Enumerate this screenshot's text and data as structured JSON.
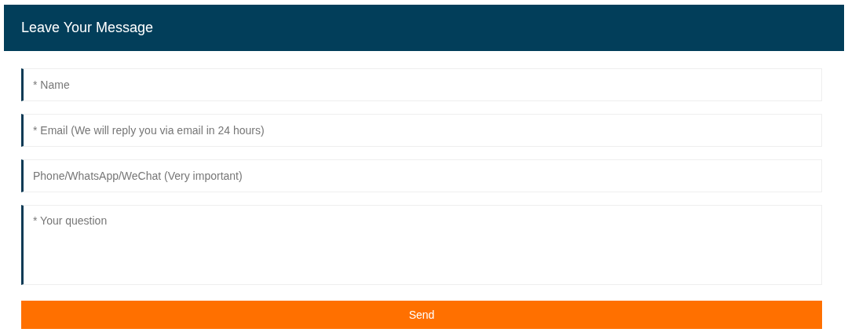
{
  "header": {
    "title": "Leave Your Message"
  },
  "fields": [
    {
      "kind": "input",
      "placeholder": "* Name"
    },
    {
      "kind": "input",
      "placeholder": "* Email (We will reply you via email in 24 hours)"
    },
    {
      "kind": "input",
      "placeholder": "Phone/WhatsApp/WeChat (Very important)"
    },
    {
      "kind": "textarea",
      "placeholder": "* Your question"
    }
  ],
  "submit": {
    "label": "Send"
  }
}
